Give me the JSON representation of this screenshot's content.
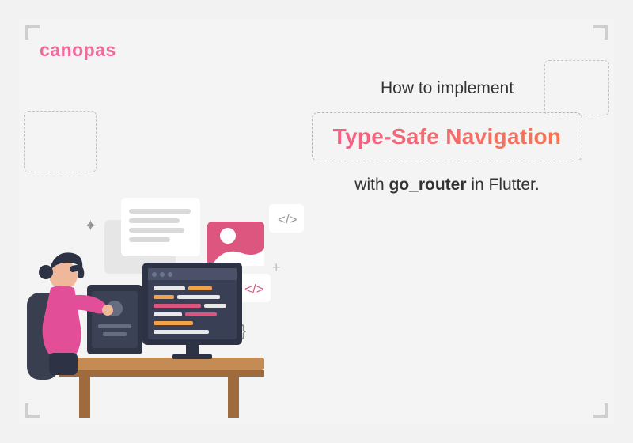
{
  "logo": "canopas",
  "headline": {
    "top": "How to implement",
    "badge": "Type-Safe Navigation",
    "bottom_prefix": "with ",
    "bottom_package": "go_router",
    "bottom_suffix": " in Flutter."
  }
}
